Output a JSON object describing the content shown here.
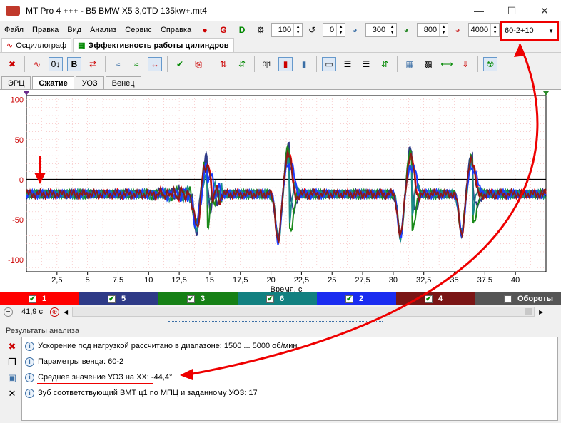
{
  "window": {
    "title": "MT Pro 4 +++ - B5 BMW X5 3,0TD 135kw+.mt4"
  },
  "menu": [
    "Файл",
    "Правка",
    "Вид",
    "Анализ",
    "Сервис",
    "Справка"
  ],
  "toolbar_values": {
    "v1": "100",
    "v2": "0",
    "v3": "300",
    "v4": "800",
    "v5": "4000"
  },
  "combo": {
    "value": "60-2+10"
  },
  "tabs_main": [
    "Осциллограф",
    "Эффективность работы цилиндров"
  ],
  "tabs_sub": [
    "ЭРЦ",
    "Сжатие",
    "УОЗ",
    "Венец"
  ],
  "chart_data": {
    "type": "line",
    "xlabel": "Время, с",
    "ylabel": "",
    "xlim": [
      0,
      42.5
    ],
    "ylim": [
      -115,
      105
    ],
    "x_ticks": [
      "2,5",
      "5",
      "7,5",
      "10",
      "12,5",
      "15",
      "17,5",
      "20",
      "22,5",
      "25",
      "27,5",
      "30",
      "32,5",
      "35",
      "37,5",
      "40"
    ],
    "y_ticks": [
      "100",
      "50",
      "0",
      "-50",
      "-100"
    ],
    "grid": true,
    "series": [
      {
        "name": "1",
        "color": "#ff0000"
      },
      {
        "name": "5",
        "color": "#2e3a87"
      },
      {
        "name": "3",
        "color": "#1a8a1a"
      },
      {
        "name": "6",
        "color": "#1a8a8a"
      },
      {
        "name": "2",
        "color": "#1a3cff"
      },
      {
        "name": "4",
        "color": "#8b1a1a"
      }
    ]
  },
  "legend": [
    {
      "label": "1",
      "color": "#ff0000",
      "checked": true
    },
    {
      "label": "5",
      "color": "#2e3a87",
      "checked": true
    },
    {
      "label": "3",
      "color": "#168016",
      "checked": true
    },
    {
      "label": "6",
      "color": "#128080",
      "checked": true
    },
    {
      "label": "2",
      "color": "#1a2cf0",
      "checked": true
    },
    {
      "label": "4",
      "color": "#7a1515",
      "checked": true
    },
    {
      "label": "Обороты",
      "color": "#555555",
      "checked": false
    }
  ],
  "position": {
    "time": "41,9 с"
  },
  "results": {
    "title": "Результаты анализа",
    "lines": [
      "Ускорение под нагрузкой рассчитано в диапазоне: 1500 ... 5000 об/мин",
      "Параметры венца: 60-2",
      "Среднее значение УОЗ на ХХ: -44,4°",
      "Зуб соответствующий ВМТ ц1 по МПЦ и заданному УОЗ: 17"
    ]
  }
}
